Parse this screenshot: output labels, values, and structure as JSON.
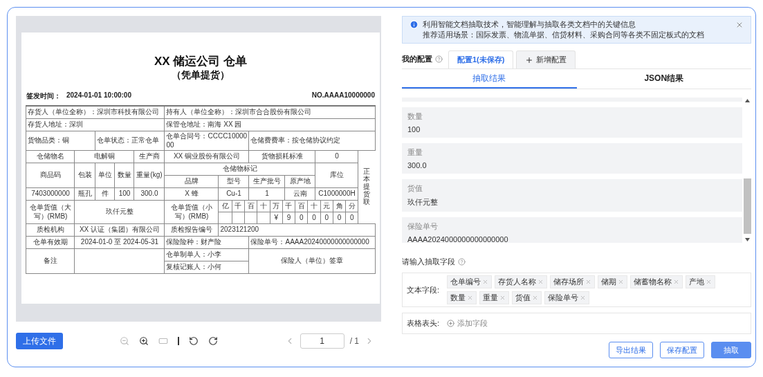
{
  "document": {
    "title": "XX 储运公司 仓单",
    "subtitle": "（凭单提货）",
    "issue_label": "签发时间：",
    "issue_time": "2024-01-01 10:00:00",
    "number": "NO.AAAA10000000",
    "table": {
      "rows": [
        [
          {
            "kind": "text",
            "text": "存货人（单位全称）：深圳市科技有限公司",
            "colspan": 5
          },
          {
            "kind": "text",
            "text": "持有人（单位全称）：深圳市合合股份有限公司",
            "colspan": 6
          }
        ],
        [
          {
            "kind": "text",
            "text": "存货人地址：深圳",
            "colspan": 5
          },
          {
            "kind": "text",
            "text": "保管仓地址：南海 XX 园",
            "colspan": 6
          }
        ],
        [
          {
            "kind": "text",
            "text": "货物品类：铜",
            "colspan": 2
          },
          {
            "kind": "text",
            "text": "仓单状态：正常仓单",
            "colspan": 3
          },
          {
            "kind": "text",
            "text": "仓单合同号：CCCC1000000",
            "colspan": 2
          },
          {
            "kind": "text",
            "text": "仓储费费率：按仓储协议约定",
            "colspan": 4
          }
        ],
        [
          {
            "kind": "text",
            "text": "仓储物名"
          },
          {
            "kind": "text",
            "text": "电解铜",
            "colspan": 3
          },
          {
            "kind": "text",
            "text": "生产商"
          },
          {
            "kind": "text",
            "text": "XX 铜业股份有限公司",
            "colspan": 2
          },
          {
            "kind": "text",
            "text": "货物损耗标准",
            "colspan": 2
          },
          {
            "kind": "text",
            "text": "0"
          },
          {
            "kind": "vertical",
            "text": "正本提货联",
            "rowspan": 5
          }
        ],
        [
          {
            "kind": "text",
            "text": "商品码",
            "rowspan": 2
          },
          {
            "kind": "text",
            "text": "包装",
            "rowspan": 2
          },
          {
            "kind": "text",
            "text": "单位",
            "rowspan": 2
          },
          {
            "kind": "text",
            "text": "数量",
            "rowspan": 2
          },
          {
            "kind": "text",
            "text": "重量(kg)",
            "rowspan": 2
          },
          {
            "kind": "text",
            "text": "仓储物标记",
            "colspan": 4
          },
          {
            "kind": "text",
            "text": "库位",
            "rowspan": 2
          }
        ],
        [
          {
            "kind": "text",
            "text": "品牌"
          },
          {
            "kind": "text",
            "text": "型号"
          },
          {
            "kind": "text",
            "text": "生产批号"
          },
          {
            "kind": "text",
            "text": "原产地"
          }
        ],
        [
          {
            "kind": "text",
            "text": "7403000000"
          },
          {
            "kind": "text",
            "text": "瓶孔"
          },
          {
            "kind": "text",
            "text": "件"
          },
          {
            "kind": "text",
            "text": "100"
          },
          {
            "kind": "text",
            "text": "300.0"
          },
          {
            "kind": "text",
            "text": "X 蜂"
          },
          {
            "kind": "text",
            "text": "Cu-1"
          },
          {
            "kind": "text",
            "text": "1"
          },
          {
            "kind": "text",
            "text": "云南"
          },
          {
            "kind": "text",
            "text": "C1000000H"
          }
        ],
        [
          {
            "kind": "text",
            "text": "仓单货值（大写）(RMB)"
          },
          {
            "kind": "text",
            "text": "玖仟元整",
            "colspan": 4
          },
          {
            "kind": "text",
            "text": "仓单货值（小写）(RMB)"
          },
          {
            "kind": "amount",
            "colspan": 4,
            "units": [
              "亿",
              "千",
              "百",
              "十",
              "万",
              "千",
              "百",
              "十",
              "元",
              "角",
              "分"
            ],
            "digits": [
              "¥",
              "9",
              "0",
              "0",
              "0",
              "0",
              "0"
            ]
          }
        ],
        [
          {
            "kind": "text",
            "text": "质检机构"
          },
          {
            "kind": "text",
            "text": "XX 认证（集团）有限公司",
            "colspan": 4
          },
          {
            "kind": "text",
            "text": "质检报告编号"
          },
          {
            "kind": "text",
            "text": "2023121200",
            "colspan": 5
          }
        ],
        [
          {
            "kind": "text",
            "text": "仓单有效期"
          },
          {
            "kind": "text",
            "text": "2024-01-0 至 2024-05-31",
            "colspan": 4
          },
          {
            "kind": "text",
            "text": "保险险种：财产险",
            "colspan": 2
          },
          {
            "kind": "text",
            "text": "保险单号：AAAA20240000000000000",
            "colspan": 4
          }
        ],
        [
          {
            "kind": "text",
            "text": "备注",
            "rowspan": 2
          },
          {
            "kind": "empty",
            "colspan": 4,
            "rowspan": 2
          },
          {
            "kind": "text",
            "text": "仓单制单人：小李",
            "colspan": 2
          },
          {
            "kind": "text",
            "text": "保险人（单位）签章",
            "colspan": 4,
            "rowspan": 2
          }
        ],
        [
          {
            "kind": "text",
            "text": "复核记账人：小何",
            "colspan": 2
          }
        ]
      ]
    }
  },
  "toolbar": {
    "upload": "上传文件",
    "page": "1",
    "total": "/ 1"
  },
  "banner": {
    "lines": [
      "利用智能文档抽取技术，智能理解与抽取各类文档中的关键信息",
      "推荐适用场景：国际发票、物流单据、信贷材料、采购合同等各类不固定板式的文档"
    ]
  },
  "config": {
    "label": "我的配置",
    "tabs": [
      {
        "label": "配置1(未保存)",
        "selected": true,
        "kind": "config"
      },
      {
        "label": "新增配置",
        "selected": false,
        "kind": "add"
      }
    ]
  },
  "result_tabs": [
    {
      "label": "抽取结果",
      "selected": true
    },
    {
      "label": "JSON结果",
      "selected": false
    }
  ],
  "results": [
    {
      "label": "数量",
      "value": "100"
    },
    {
      "label": "重量",
      "value": "300.0"
    },
    {
      "label": "货值",
      "value": "玖仟元整"
    },
    {
      "label": "保险单号",
      "value": "AAAA2024000000000000000"
    }
  ],
  "fields": {
    "title": "请输入抽取字段",
    "text_label": "文本字段:",
    "tags": [
      "仓单编号",
      "存货人名称",
      "储存场所",
      "储期",
      "储蓄物名称",
      "产地",
      "数量",
      "重量",
      "货值",
      "保险单号"
    ],
    "table_label": "表格表头:",
    "add": "添加字段"
  },
  "buttons": [
    {
      "label": "导出结果",
      "kind": "outline"
    },
    {
      "label": "保存配置",
      "kind": "outline"
    },
    {
      "label": "抽取",
      "kind": "primary"
    }
  ]
}
